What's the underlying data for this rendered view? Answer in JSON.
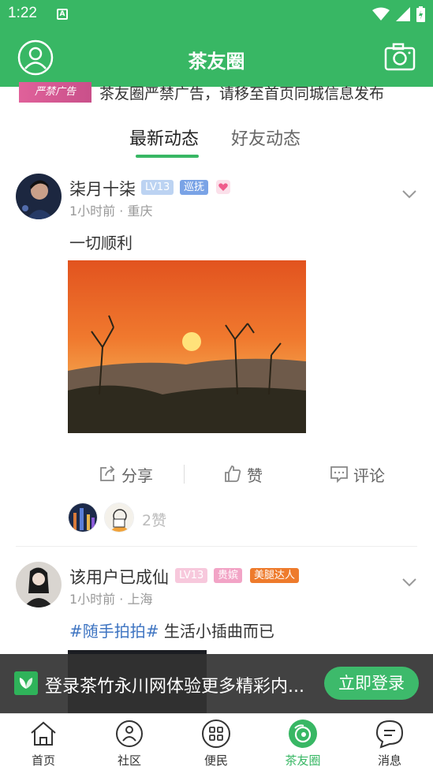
{
  "status_bar": {
    "time": "1:22",
    "notif_letter": "A"
  },
  "app_bar": {
    "title": "茶友圈",
    "left_icon": "profile-icon",
    "right_icon": "camera-icon"
  },
  "notice": {
    "ad_label": "严禁广告",
    "text": "茶友圈严禁广告，请移至首页同城信息发布"
  },
  "tabs": [
    {
      "label": "最新动态",
      "active": true
    },
    {
      "label": "好友动态",
      "active": false
    }
  ],
  "posts": [
    {
      "username": "柒月十柒",
      "badges": [
        "LV13",
        "巡抚"
      ],
      "time": "1小时前",
      "location": "重庆",
      "meta": "1小时前 · 重庆",
      "text": "一切顺利",
      "image": "sunset",
      "actions": {
        "share": "分享",
        "like": "赞",
        "comment": "评论"
      },
      "likes": "2赞"
    },
    {
      "username": "该用户已成仙",
      "badges": [
        "LV13",
        "贵嫔",
        "美腿达人"
      ],
      "time": "1小时前",
      "location": "上海",
      "meta": "1小时前 · 上海",
      "hashtag": "#随手拍拍#",
      "text": " 生活小插曲而已"
    }
  ],
  "login_banner": {
    "message": "登录茶竹永川网体验更多精彩内...",
    "button": "立即登录"
  },
  "bottom_nav": [
    {
      "label": "首页",
      "icon": "home-icon"
    },
    {
      "label": "社区",
      "icon": "community-icon"
    },
    {
      "label": "便民",
      "icon": "services-icon"
    },
    {
      "label": "茶友圈",
      "icon": "tea-circle-icon",
      "active": true
    },
    {
      "label": "消息",
      "icon": "message-icon"
    }
  ],
  "colors": {
    "brand_green": "#38b764",
    "hashtag_blue": "#3f75c2",
    "badge_pink": "#f2a4c6",
    "badge_orange": "#ee7b2c"
  }
}
